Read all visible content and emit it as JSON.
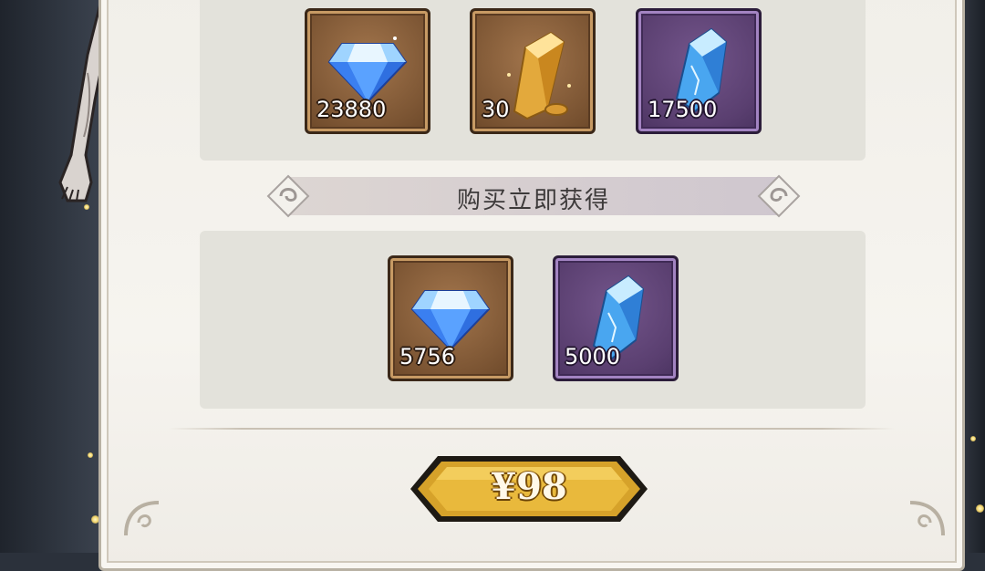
{
  "colors": {
    "panel_bg": "#f3f1ec",
    "group_bg": "#e3e2db",
    "tile_brown": "#7d5634",
    "tile_purple": "#5a3f70",
    "price_gold": "#d9a62c"
  },
  "rewards_top": [
    {
      "icon": "diamond-icon",
      "quantity": "23880",
      "frame": "brown"
    },
    {
      "icon": "amber-crystal-icon",
      "quantity": "30",
      "frame": "brown"
    },
    {
      "icon": "blue-crystal-icon",
      "quantity": "17500",
      "frame": "purple"
    }
  ],
  "banner": {
    "text": "购买立即获得"
  },
  "rewards_instant": [
    {
      "icon": "diamond-icon",
      "quantity": "5756",
      "frame": "brown"
    },
    {
      "icon": "blue-crystal-icon",
      "quantity": "5000",
      "frame": "purple"
    }
  ],
  "purchase": {
    "price_label": "¥98"
  }
}
